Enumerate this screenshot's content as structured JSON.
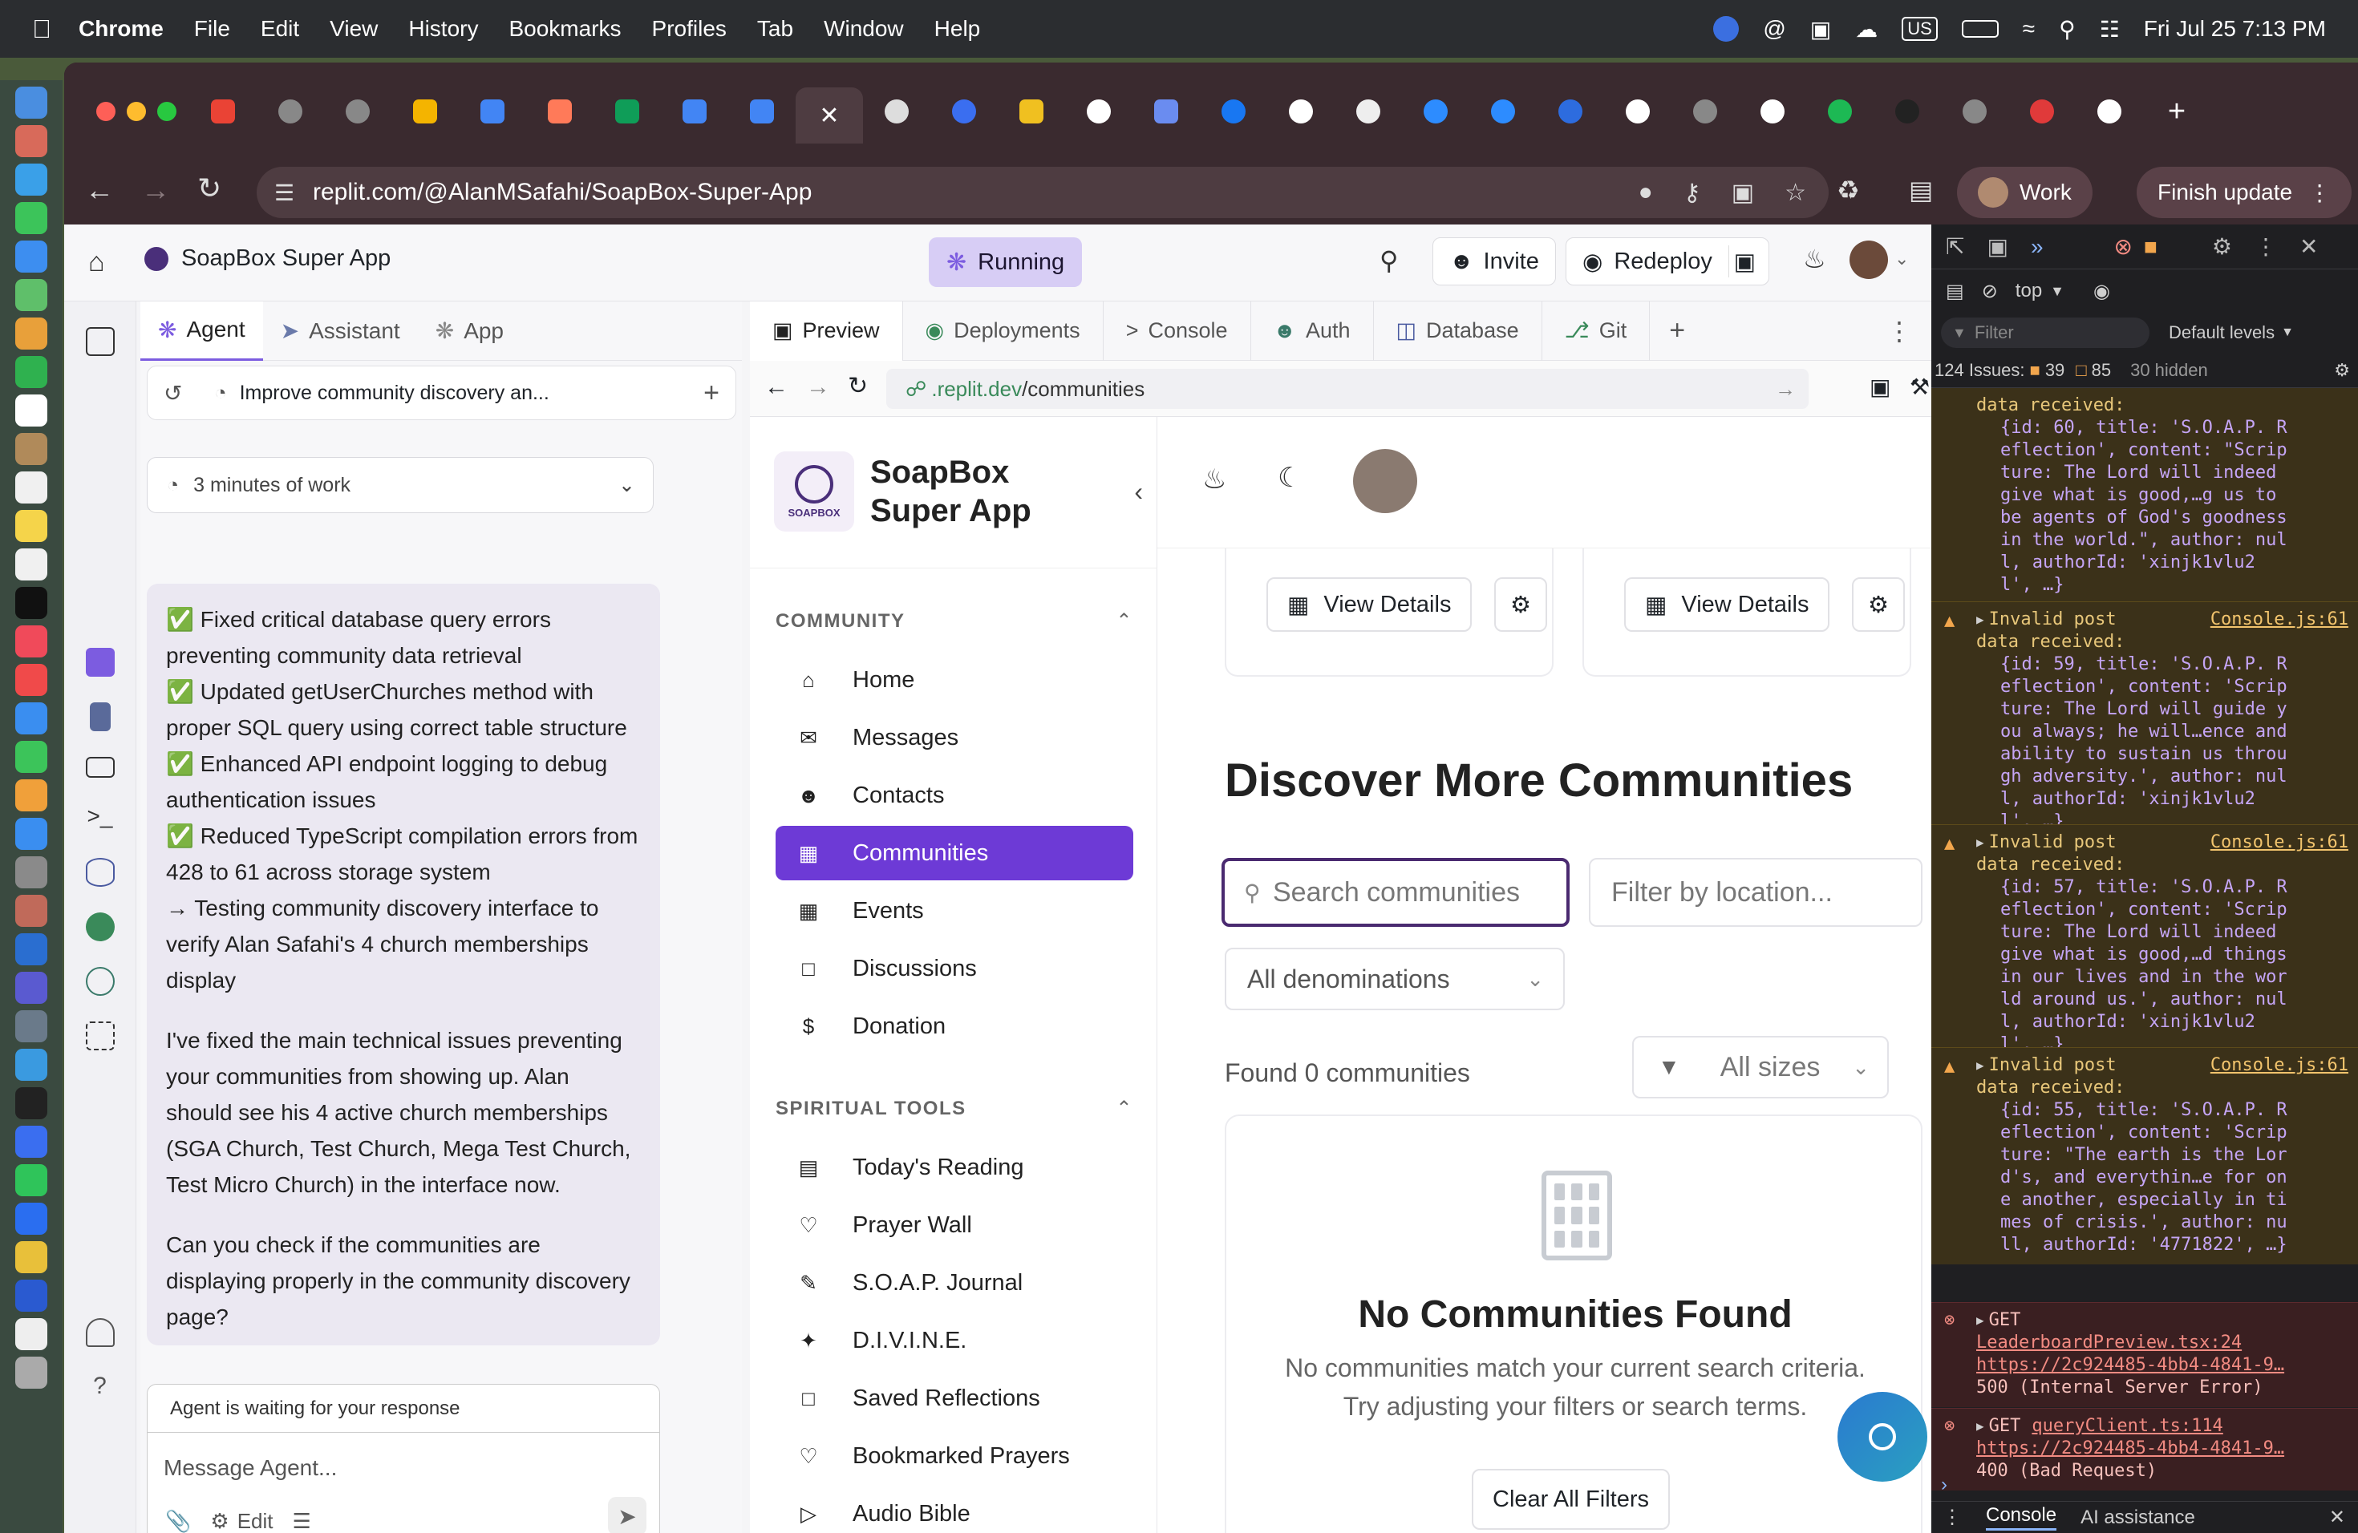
{
  "menubar": {
    "app": "Chrome",
    "items": [
      "File",
      "Edit",
      "View",
      "History",
      "Bookmarks",
      "Profiles",
      "Tab",
      "Window",
      "Help"
    ],
    "clock": "Fri Jul 25  7:13 PM",
    "input_source": "US"
  },
  "browser": {
    "url": "replit.com/@AlanMSafahi/SoapBox-Super-App",
    "profile_label": "Work",
    "update_label": "Finish update"
  },
  "replit": {
    "project_name": "SoapBox Super App",
    "run_status": "Running",
    "invite_label": "Invite",
    "redeploy_label": "Redeploy",
    "agent_tabs": [
      "Agent",
      "Assistant",
      "App"
    ],
    "task_title": "Improve community discovery an...",
    "work_summary": "3 minutes of work",
    "agent_message": {
      "bullets": [
        "✅ Fixed critical database query errors preventing community data retrieval",
        "✅ Updated getUserChurches method with proper SQL query using correct table structure",
        "✅ Enhanced API endpoint logging to debug authentication issues",
        "✅ Reduced TypeScript compilation errors from 428 to 61 across storage system",
        "→ Testing community discovery interface to verify Alan Safahi's 4 church memberships display"
      ],
      "para1": "I've fixed the main technical issues preventing your communities from showing up. Alan should see his 4 active church memberships (SGA Church, Test Church, Mega Test Church, Test Micro Church) in the interface now.",
      "para2": "Can you check if the communities are displaying properly in the community discovery page?"
    },
    "waiting_text": "Agent is waiting for your response",
    "input_placeholder": "Message Agent...",
    "edit_label": "Edit"
  },
  "preview": {
    "tabs": [
      "Preview",
      "Deployments",
      "Console",
      "Auth",
      "Database",
      "Git"
    ],
    "url_host": ".replit.dev",
    "url_path": "/communities"
  },
  "app": {
    "brand_line1": "SoapBox",
    "brand_line2": "Super App",
    "logo_text": "SOAPBOX",
    "section_community": "COMMUNITY",
    "community_nav": [
      "Home",
      "Messages",
      "Contacts",
      "Communities",
      "Events",
      "Discussions",
      "Donation"
    ],
    "section_spiritual": "SPIRITUAL TOOLS",
    "spiritual_nav": [
      "Today's Reading",
      "Prayer Wall",
      "S.O.A.P. Journal",
      "D.I.V.I.N.E.",
      "Saved Reflections",
      "Bookmarked Prayers",
      "Audio Bible"
    ],
    "view_details": "View Details",
    "discover_title": "Discover More Communities",
    "search_placeholder": "Search communities",
    "location_placeholder": "Filter by location...",
    "denomination_select": "All denominations",
    "found_text": "Found 0 communities",
    "size_select": "All sizes",
    "empty_title": "No Communities Found",
    "empty_line1": "No communities match your current search criteria.",
    "empty_line2": "Try adjusting your filters or search terms.",
    "clear_filters": "Clear All Filters",
    "accent_color": "#6d3ad6"
  },
  "devtools": {
    "context": "top",
    "filter_placeholder": "Filter",
    "levels": "Default levels",
    "issues_summary": "124 Issues:",
    "warn_count": "39",
    "info_count": "85",
    "hidden": "30 hidden",
    "first_received": "data received:",
    "first_lines": [
      "{id: 60, title: 'S.O.A.P. R",
      "eflection', content: \"Scrip",
      "ture: The Lord will indeed",
      "give what is good,…g us to",
      "be agents of God's goodness",
      "in the world.\", author: nul",
      "l, authorId: 'xinjk1vlu2",
      "l', …}"
    ],
    "warnings": [
      {
        "title": "Invalid post",
        "source": "Console.js:61",
        "lines": [
          "data received:",
          "{id: 59, title: 'S.O.A.P. R",
          "eflection', content: 'Scrip",
          "ture: The Lord will guide y",
          "ou always; he will…ence and",
          "ability to sustain us throu",
          "gh adversity.', author: nul",
          "l, authorId: 'xinjk1vlu2",
          "l', …}"
        ]
      },
      {
        "title": "Invalid post",
        "source": "Console.js:61",
        "lines": [
          "data received:",
          "{id: 57, title: 'S.O.A.P. R",
          "eflection', content: 'Scrip",
          "ture: The Lord will indeed",
          "give what is good,…d things",
          "in our lives and in the wor",
          "ld around us.', author: nul",
          "l, authorId: 'xinjk1vlu2",
          "l', …}"
        ]
      },
      {
        "title": "Invalid post",
        "source": "Console.js:61",
        "lines": [
          "data received:",
          "{id: 55, title: 'S.O.A.P. R",
          "eflection', content: 'Scrip",
          "ture: \"The earth is the Lor",
          "d's, and everythin…e for on",
          "e another, especially in ti",
          "mes of crisis.', author: nu",
          "ll, authorId: '4771822', …}"
        ]
      }
    ],
    "errors": [
      {
        "method": "GET",
        "source": "LeaderboardPreview.tsx:24",
        "url": "https://2c924485-4bb4-4841-9…",
        "status": "500 (Internal Server Error)"
      },
      {
        "method": "GET",
        "source": "queryClient.ts:114",
        "url": "https://2c924485-4bb4-4841-9…",
        "status": "400 (Bad Request)"
      }
    ],
    "drawer_tabs": [
      "Console",
      "AI assistance"
    ]
  }
}
